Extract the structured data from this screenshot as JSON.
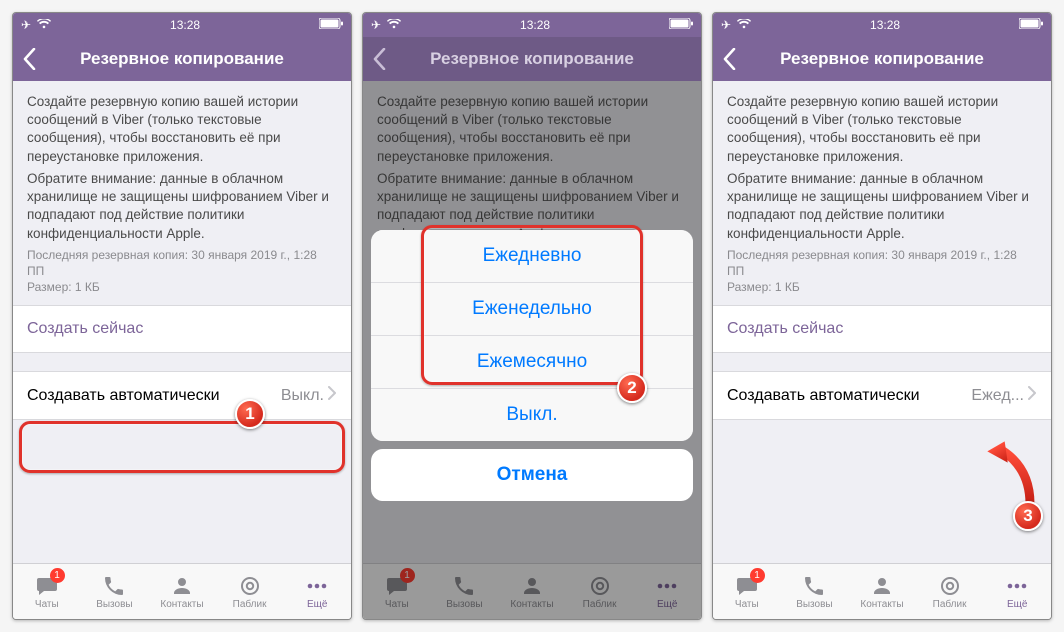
{
  "status": {
    "time": "13:28"
  },
  "nav": {
    "title": "Резервное копирование"
  },
  "desc": {
    "p1": "Создайте резервную копию вашей истории сообщений в Viber (только текстовые сообщения), чтобы восстановить её при переустановке приложения.",
    "p2": "Обратите внимание: данные в облачном хранилище не защищены шифрованием Viber и подпадают под действие политики конфиденциальности Apple."
  },
  "meta": {
    "last": "Последняя резервная копия: 30 января 2019 г., 1:28 ПП",
    "size": "Размер: 1 КБ"
  },
  "cells": {
    "backup_now": "Создать сейчас",
    "auto_label": "Создавать автоматически",
    "auto_value_off": "Выкл.",
    "auto_value_daily": "Ежед..."
  },
  "sheet": {
    "daily": "Ежедневно",
    "weekly": "Еженедельно",
    "monthly": "Ежемесячно",
    "off": "Выкл.",
    "cancel": "Отмена"
  },
  "tabs": {
    "chats": "Чаты",
    "calls": "Вызовы",
    "contacts": "Контакты",
    "public": "Паблик",
    "more": "Ещё",
    "badge": "1"
  },
  "callouts": {
    "n1": "1",
    "n2": "2",
    "n3": "3"
  }
}
